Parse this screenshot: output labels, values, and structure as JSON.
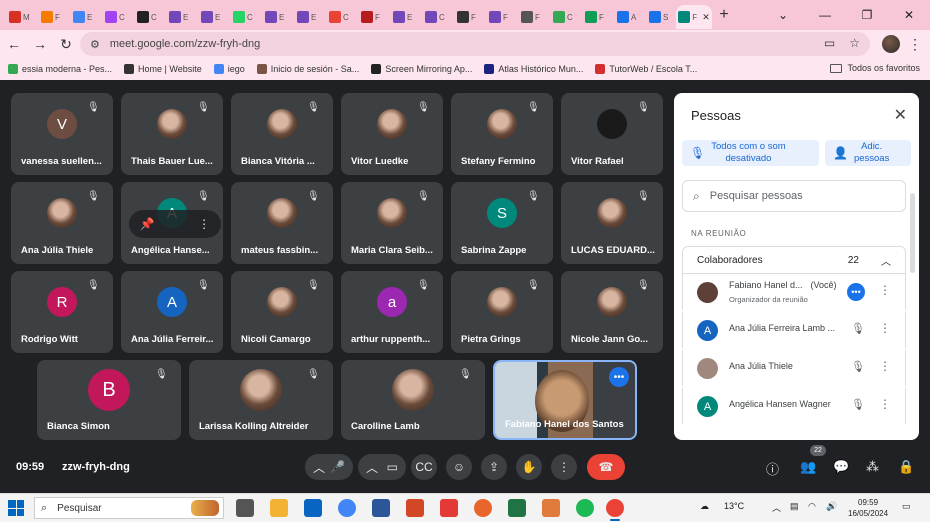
{
  "browser": {
    "tabs": [
      {
        "icon": "gmail-icon",
        "color": "#d93025",
        "label": "M"
      },
      {
        "icon": "fire-icon",
        "color": "#f57c00",
        "label": "F"
      },
      {
        "icon": "docs-icon",
        "color": "#4285f4",
        "label": "E"
      },
      {
        "icon": "clock-icon",
        "color": "#a142f4",
        "label": "C"
      },
      {
        "icon": "amazon-icon",
        "color": "#222222",
        "label": "C"
      },
      {
        "icon": "forms-icon",
        "color": "#7248b9",
        "label": "E"
      },
      {
        "icon": "forms-icon",
        "color": "#7248b9",
        "label": "E"
      },
      {
        "icon": "whatsapp-icon",
        "color": "#25d366",
        "label": "C"
      },
      {
        "icon": "forms-icon",
        "color": "#7248b9",
        "label": "E"
      },
      {
        "icon": "forms-icon",
        "color": "#7248b9",
        "label": "E"
      },
      {
        "icon": "apps-icon",
        "color": "#ea4335",
        "label": "C"
      },
      {
        "icon": "app-icon",
        "color": "#b71c1c",
        "label": "F"
      },
      {
        "icon": "forms-icon",
        "color": "#7248b9",
        "label": "E"
      },
      {
        "icon": "forms-icon",
        "color": "#7248b9",
        "label": "C"
      },
      {
        "icon": "hourglass-icon",
        "color": "#333333",
        "label": "F"
      },
      {
        "icon": "forms-icon",
        "color": "#7248b9",
        "label": "F"
      },
      {
        "icon": "openai-icon",
        "color": "#555555",
        "label": "F"
      },
      {
        "icon": "maps-icon",
        "color": "#34a853",
        "label": "C"
      },
      {
        "icon": "sheet-icon",
        "color": "#0f9d58",
        "label": "F"
      },
      {
        "icon": "vimeo-icon",
        "color": "#1a73e8",
        "label": "A"
      },
      {
        "icon": "vimeo-icon",
        "color": "#1a73e8",
        "label": "S"
      },
      {
        "icon": "meet-icon",
        "color": "#00897b",
        "label": "F"
      }
    ],
    "new_tab": "+",
    "url": "meet.google.com/zzw-fryh-dng",
    "bookmarks": [
      {
        "label": "essia moderna - Pes...",
        "color": "#34a853"
      },
      {
        "label": "Home | Website",
        "color": "#333333"
      },
      {
        "label": "iego",
        "color": "#4285f4"
      },
      {
        "label": "Inicio de sesión - Sa...",
        "color": "#795548"
      },
      {
        "label": "Screen Mirroring Ap...",
        "color": "#222222"
      },
      {
        "label": "Atlas Histórico Mun...",
        "color": "#1a237e"
      },
      {
        "label": "TutorWeb / Escola T...",
        "color": "#d32f2f"
      }
    ],
    "all_bookmarks": "Todos os favoritos"
  },
  "tiles": [
    {
      "name": "vanessa suellen...",
      "avatar": "V",
      "color": "#6d4c41",
      "photo": false
    },
    {
      "name": "Thais Bauer Lue...",
      "avatar": "",
      "color": "",
      "photo": true
    },
    {
      "name": "Bianca Vitória ...",
      "avatar": "",
      "color": "",
      "photo": true
    },
    {
      "name": "Vitor Luedke",
      "avatar": "",
      "color": "",
      "photo": true
    },
    {
      "name": "Stefany Fermino",
      "avatar": "",
      "color": "",
      "photo": true
    },
    {
      "name": "Vitor Rafael",
      "avatar": "",
      "color": "#1a1a1a",
      "photo": true
    },
    {
      "name": "Ana Júlia Thiele",
      "avatar": "",
      "color": "",
      "photo": true
    },
    {
      "name": "Angélica Hanse...",
      "avatar": "A",
      "color": "#00897b",
      "photo": false
    },
    {
      "name": "mateus fassbin...",
      "avatar": "",
      "color": "",
      "photo": true
    },
    {
      "name": "Maria Clara Seib...",
      "avatar": "",
      "color": "",
      "photo": true
    },
    {
      "name": "Sabrina Zappe",
      "avatar": "S",
      "color": "#00897b",
      "photo": false
    },
    {
      "name": "LUCAS EDUARD...",
      "avatar": "",
      "color": "",
      "photo": true
    },
    {
      "name": "Rodrigo Witt",
      "avatar": "R",
      "color": "#c2185b",
      "photo": false
    },
    {
      "name": "Ana Júlia Ferreir...",
      "avatar": "A",
      "color": "#1565c0",
      "photo": false
    },
    {
      "name": "Nicoli Camargo",
      "avatar": "",
      "color": "",
      "photo": true
    },
    {
      "name": "arthur ruppenth...",
      "avatar": "a",
      "color": "#9c27b0",
      "photo": false
    },
    {
      "name": "Pietra Grings",
      "avatar": "",
      "color": "",
      "photo": true
    },
    {
      "name": "Nicole Jann Go...",
      "avatar": "",
      "color": "",
      "photo": true
    },
    {
      "name": "Bianca Simon",
      "avatar": "B",
      "color": "#c2185b",
      "photo": false
    },
    {
      "name": "Larissa Kolling Altreider",
      "avatar": "",
      "color": "",
      "photo": true
    },
    {
      "name": "Carolline Lamb",
      "avatar": "",
      "color": "",
      "photo": true
    }
  ],
  "self_tile": {
    "name": "Fabiano Hanel dos Santos"
  },
  "panel": {
    "title": "Pessoas",
    "mute_all": "Todos com o som\ndesativado",
    "add_people": "Adic.\npessoas",
    "search_placeholder": "Pesquisar pessoas",
    "section": "NA REUNIÃO",
    "group_label": "Colaboradores",
    "group_count": "22",
    "people": [
      {
        "name": "Fabiano Hanel d...",
        "you": "(Você)",
        "role": "Organizador da reunião",
        "avatar": "",
        "color": "#5d4037"
      },
      {
        "name": "Ana Júlia Ferreira Lamb ...",
        "you": "",
        "role": "",
        "avatar": "A",
        "color": "#1565c0"
      },
      {
        "name": "Ana Júlia Thiele",
        "you": "",
        "role": "",
        "avatar": "",
        "color": "#a1887f"
      },
      {
        "name": "Angélica Hansen Wagner",
        "you": "",
        "role": "",
        "avatar": "A",
        "color": "#00897b"
      }
    ]
  },
  "meeting": {
    "time": "09:59",
    "code": "zzw-fryh-dng",
    "people_badge": "22"
  },
  "taskbar": {
    "search": "Pesquisar",
    "weather": "13°C",
    "time": "09:59",
    "date": "16/05/2024"
  }
}
